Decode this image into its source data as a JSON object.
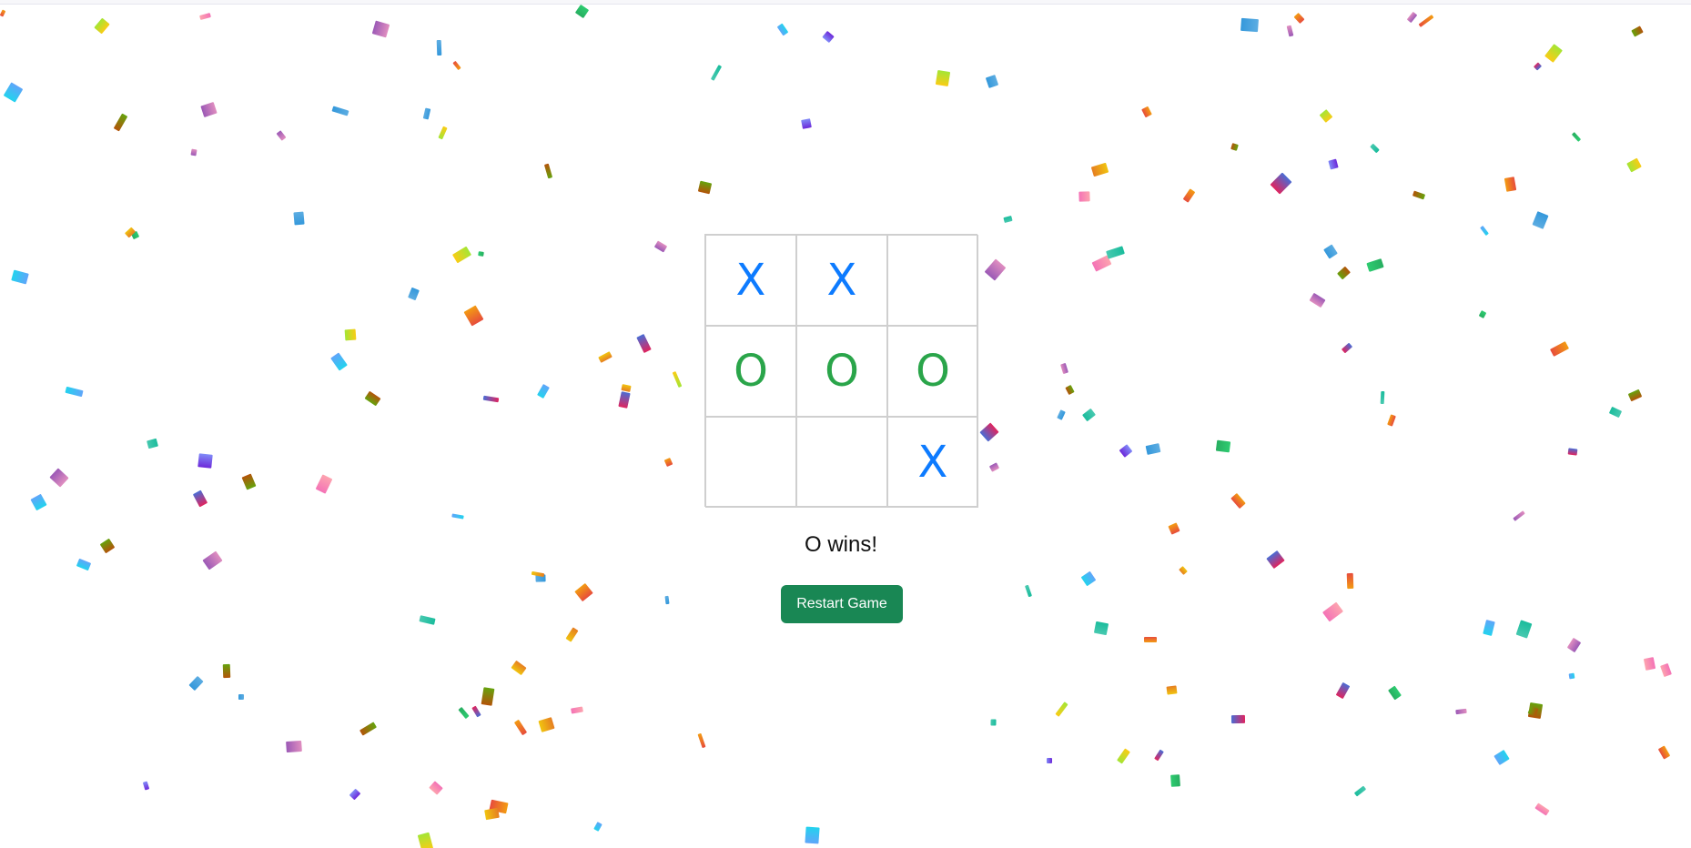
{
  "board": {
    "cells": [
      "X",
      "X",
      "",
      "O",
      "O",
      "O",
      "",
      "",
      "X"
    ]
  },
  "status": {
    "text": "O wins!"
  },
  "controls": {
    "restart_label": "Restart Game"
  },
  "colors": {
    "x_mark": "#0d7bff",
    "o_mark": "#2aa54a",
    "button_bg": "#198754"
  }
}
